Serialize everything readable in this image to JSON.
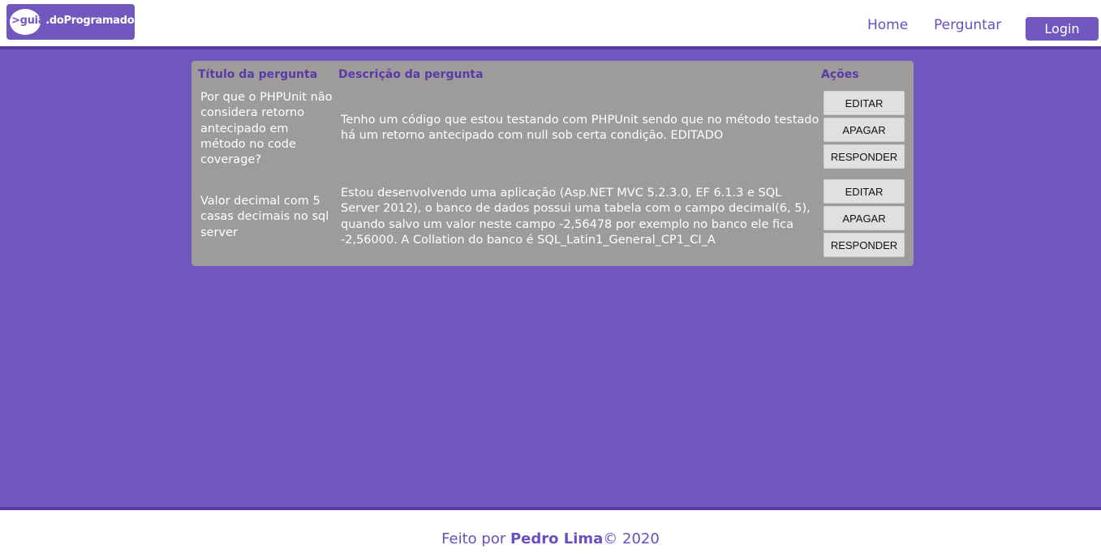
{
  "header": {
    "logo": {
      "prefix": ">guia",
      "rest": ".doProgramador",
      "cursor": "_"
    },
    "nav": [
      {
        "label": "Home"
      },
      {
        "label": "Perguntar"
      }
    ],
    "login_label": "Login"
  },
  "table": {
    "columns": [
      "Título da pergunta",
      "Descrição da pergunta",
      "Ações"
    ],
    "rows": [
      {
        "title": "Por que o PHPUnit não considera retorno antecipado em método no code coverage?",
        "description": "Tenho um código que estou testando com PHPUnit sendo que no método testado há um retorno antecipado com null sob certa condição. EDITADO",
        "actions": [
          "EDITAR",
          "APAGAR",
          "RESPONDER"
        ]
      },
      {
        "title": "Valor decimal com 5 casas decimais no sql server",
        "description": "Estou desenvolvendo uma aplicação (Asp.NET MVC 5.2.3.0, EF 6.1.3 e SQL Server 2012), o banco de dados possui uma tabela com o campo decimal(6, 5), quando salvo um valor neste campo -2,56478 por exemplo no banco ele fica -2,56000. A Collation do banco é SQL_Latin1_General_CP1_CI_A",
        "actions": [
          "EDITAR",
          "APAGAR",
          "RESPONDER"
        ]
      }
    ]
  },
  "footer": {
    "prefix": "Feito por ",
    "author": "Pedro Lima",
    "suffix": "© 2020"
  },
  "colors": {
    "brand": "#7158bf",
    "accent_dark": "#5a3aa8",
    "card": "#9e9b9b",
    "button": "#e0e0e0"
  }
}
